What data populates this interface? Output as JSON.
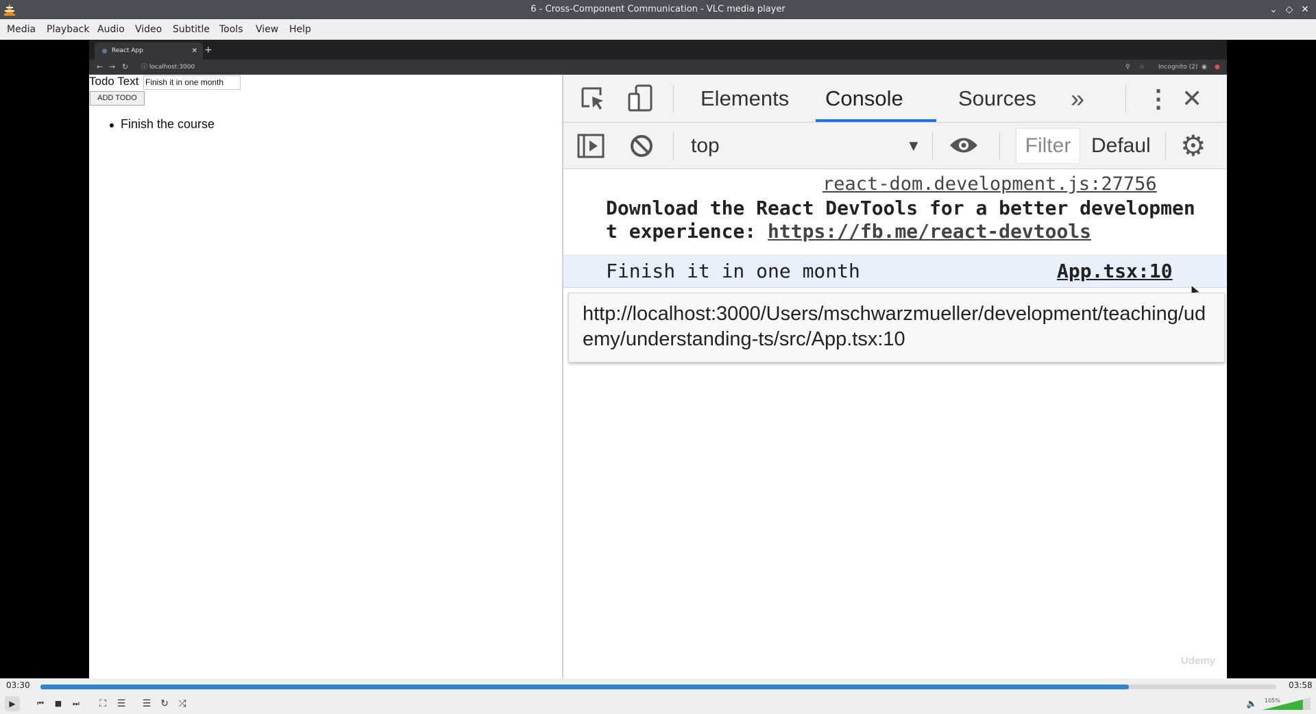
{
  "window": {
    "title": "6 - Cross-Component Communication - VLC media player"
  },
  "menu": {
    "items": [
      "Media",
      "Playback",
      "Audio",
      "Video",
      "Subtitle",
      "Tools",
      "View",
      "Help"
    ]
  },
  "browser": {
    "tab_title": "React App",
    "new_tab": "+",
    "url": "localhost:3000",
    "incognito": "Incognito (2)"
  },
  "app": {
    "label": "Todo Text",
    "input_value": "Finish it in one month",
    "button": "ADD TODO",
    "todos": [
      "Finish the course"
    ]
  },
  "devtools": {
    "tabs": [
      "Elements",
      "Console",
      "Sources"
    ],
    "active_tab": "Console",
    "context": "top",
    "filter_placeholder": "Filter",
    "levels": "Defaul",
    "messages": {
      "m1_source": "react-dom.development.js:27756",
      "m1_text": "Download the React DevTools for a better development experience: ",
      "m1_link": "https://fb.me/react-devtools",
      "m2_text": "Finish it in one month",
      "m2_source": "App.tsx:10"
    },
    "tooltip": "http://localhost:3000/Users/mschwarzmueller/development/teaching/udemy/understanding-ts/src/App.tsx:10"
  },
  "watermark": "Udemy",
  "player": {
    "elapsed": "03:30",
    "total": "03:58",
    "progress": 0.881,
    "volume_label": "105%",
    "volume": 1.05,
    "accent": "#2f84d0",
    "volume_color": "#3bb33b"
  }
}
